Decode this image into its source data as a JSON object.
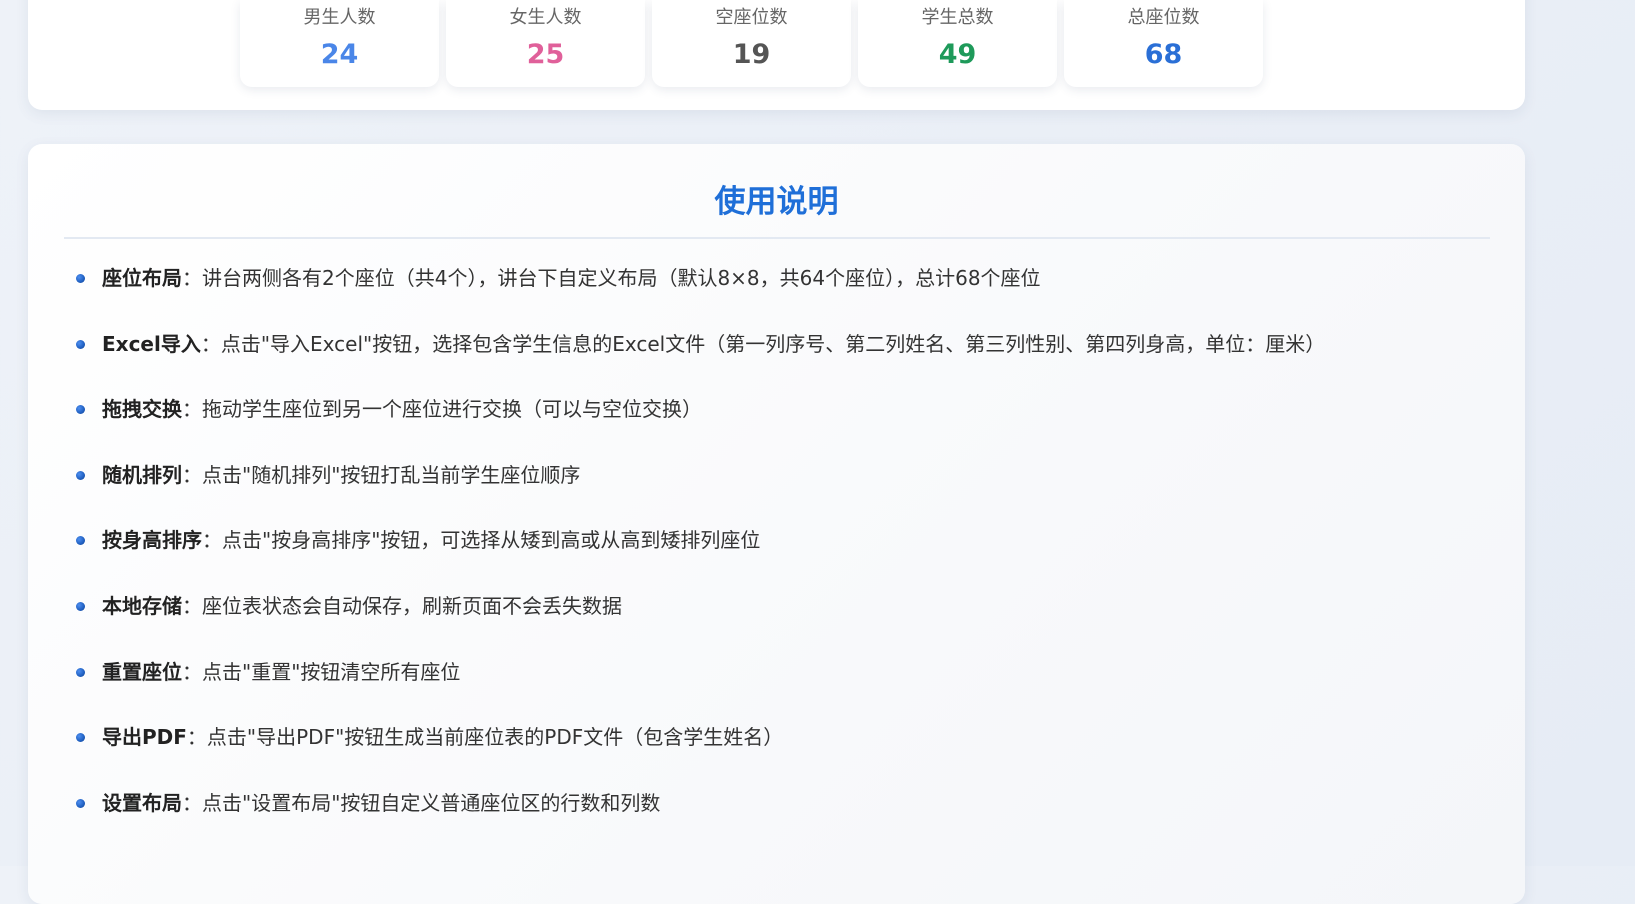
{
  "stats": [
    {
      "label": "男生人数",
      "value": "24",
      "color": "#4a86e8"
    },
    {
      "label": "女生人数",
      "value": "25",
      "color": "#e0609a"
    },
    {
      "label": "空座位数",
      "value": "19",
      "color": "#555555"
    },
    {
      "label": "学生总数",
      "value": "49",
      "color": "#1e9a5a"
    },
    {
      "label": "总座位数",
      "value": "68",
      "color": "#2a6fd6"
    }
  ],
  "instructions": {
    "title": "使用说明",
    "separator": "：",
    "items": [
      {
        "term": "座位布局",
        "desc": "讲台两侧各有2个座位（共4个），讲台下自定义布局（默认8×8，共64个座位），总计68个座位"
      },
      {
        "term": "Excel导入",
        "desc": "点击\"导入Excel\"按钮，选择包含学生信息的Excel文件（第一列序号、第二列姓名、第三列性别、第四列身高，单位：厘米）"
      },
      {
        "term": "拖拽交换",
        "desc": "拖动学生座位到另一个座位进行交换（可以与空位交换）"
      },
      {
        "term": "随机排列",
        "desc": "点击\"随机排列\"按钮打乱当前学生座位顺序"
      },
      {
        "term": "按身高排序",
        "desc": "点击\"按身高排序\"按钮，可选择从矮到高或从高到矮排列座位"
      },
      {
        "term": "本地存储",
        "desc": "座位表状态会自动保存，刷新页面不会丢失数据"
      },
      {
        "term": "重置座位",
        "desc": "点击\"重置\"按钮清空所有座位"
      },
      {
        "term": "导出PDF",
        "desc": "点击\"导出PDF\"按钮生成当前座位表的PDF文件（包含学生姓名）"
      },
      {
        "term": "设置布局",
        "desc": "点击\"设置布局\"按钮自定义普通座位区的行数和列数"
      }
    ]
  }
}
